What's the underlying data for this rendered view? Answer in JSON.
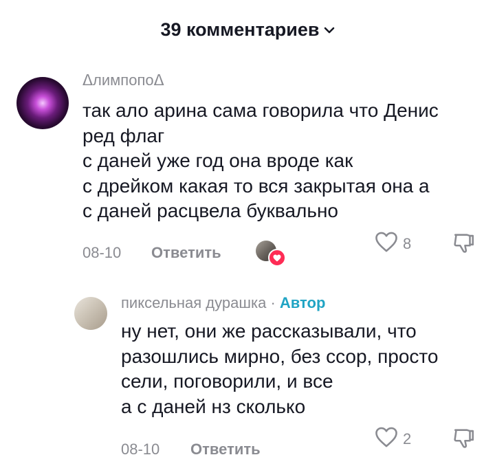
{
  "header": {
    "title": "39 комментариев"
  },
  "comments": [
    {
      "username": "ᐃлимпопоᐃ",
      "lines": [
        "так ало арина сама говорила что Денис",
        "ред флаг",
        "с даней уже год она вроде как",
        "с дрейком какая то вся закрытая она а",
        "с даней расцвела буквально"
      ],
      "date": "08-10",
      "reply_label": "Ответить",
      "likes": "8"
    },
    {
      "username": "пиксельная дурашка",
      "separator": "·",
      "author_badge": "Автор",
      "lines": [
        "ну нет, они же рассказывали, что",
        "разошлись мирно, без ссор, просто",
        "сели, поговорили, и все",
        "а с даней нз сколько"
      ],
      "date": "08-10",
      "reply_label": "Ответить",
      "likes": "2"
    }
  ],
  "colors": {
    "text": "#161823",
    "muted": "#8a8b91",
    "author": "#20a4c4",
    "heart": "#fe2c55"
  },
  "icons": [
    "chevron-down-icon",
    "heart-outline-icon",
    "dislike-icon",
    "creator-liked-icon"
  ]
}
